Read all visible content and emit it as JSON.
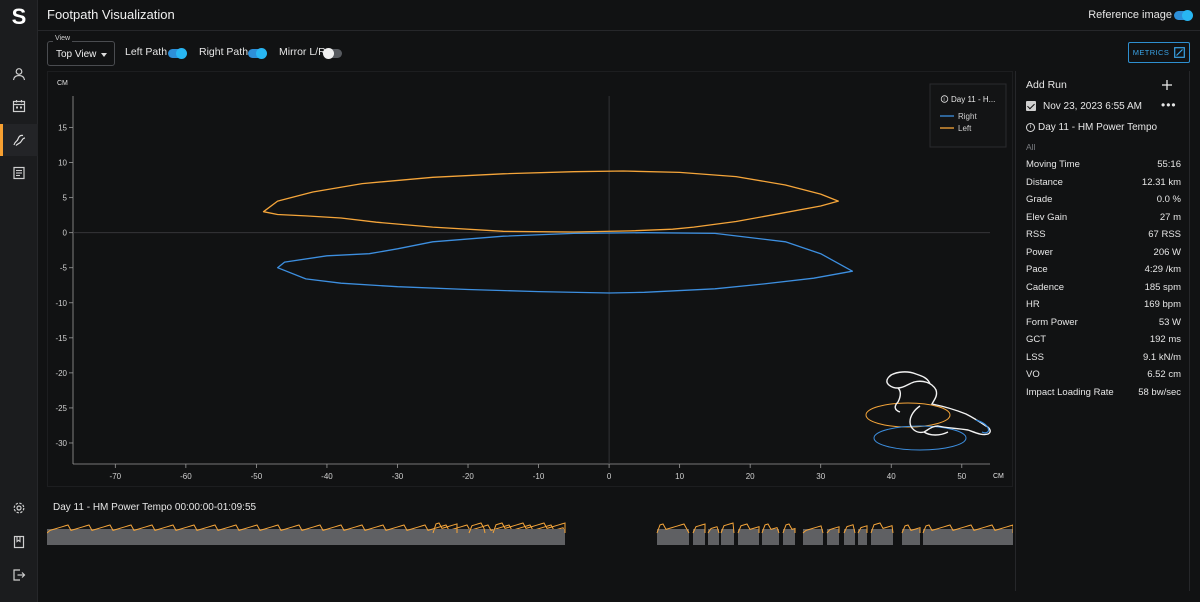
{
  "app": {
    "title": "Footpath Visualization",
    "logo": "S"
  },
  "header": {
    "reference_image_label": "Reference image",
    "reference_image_on": true
  },
  "sidebar": {
    "items": [
      {
        "icon": "user-icon"
      },
      {
        "icon": "calendar-icon"
      },
      {
        "icon": "footpath-icon",
        "active": true
      },
      {
        "icon": "report-icon"
      },
      {
        "icon": "gear-icon"
      },
      {
        "icon": "book-icon"
      },
      {
        "icon": "logout-icon"
      }
    ]
  },
  "controls": {
    "view_legend": "View",
    "view_value": "Top View",
    "left_path_label": "Left Path",
    "right_path_label": "Right Path",
    "mirror_label": "Mirror L/R",
    "left_path_on": true,
    "right_path_on": true,
    "mirror_on": false,
    "metrics_button": "METRICS"
  },
  "chart_data": {
    "type": "line",
    "xlabel": "CM",
    "ylabel": "CM",
    "xlim": [
      -76,
      54
    ],
    "ylim": [
      -33,
      19.5
    ],
    "x_ticks": [
      -70,
      -60,
      -50,
      -40,
      -30,
      -20,
      -10,
      0,
      10,
      20,
      30,
      40,
      50
    ],
    "y_ticks": [
      15,
      10,
      5,
      0,
      -5,
      -10,
      -15,
      -20,
      -25,
      -30
    ],
    "legend": {
      "title": "Day 11 - H...",
      "position": "top-right"
    },
    "series": [
      {
        "name": "Left",
        "color": "#f5a53a",
        "closed": true,
        "x": [
          -49,
          -47,
          -42,
          -35,
          -25,
          -15,
          -5,
          2,
          10,
          18,
          25,
          30,
          32.5,
          30,
          24,
          18,
          12,
          9,
          3,
          -5,
          -15,
          -25,
          -33,
          -38,
          -43,
          -47,
          -49
        ],
        "y": [
          3,
          4.5,
          5.8,
          7,
          7.9,
          8.4,
          8.7,
          8.8,
          8.6,
          8,
          6.8,
          5.5,
          4.5,
          3.8,
          2.7,
          1.6,
          0.8,
          0.5,
          0.25,
          0.1,
          0.2,
          0.8,
          1.5,
          2.1,
          2.4,
          2.6,
          3
        ]
      },
      {
        "name": "Right",
        "color": "#3d8fe0",
        "closed": true,
        "x": [
          -47,
          -46,
          -40,
          -34,
          -30,
          -25,
          -15,
          -5,
          5,
          15,
          25,
          30,
          34.5,
          29,
          22,
          15,
          5,
          0,
          -10,
          -20,
          -30,
          -38,
          -43,
          -47
        ],
        "y": [
          -5,
          -4.2,
          -3.3,
          -3,
          -2.3,
          -1.3,
          -0.5,
          -0.1,
          0,
          -0.1,
          -1.3,
          -3,
          -5.5,
          -6.5,
          -7.3,
          -8,
          -8.5,
          -8.6,
          -8.4,
          -8.1,
          -7.7,
          -7.2,
          -6.6,
          -5
        ]
      }
    ]
  },
  "run": {
    "add_run_label": "Add Run",
    "date": "Nov 23, 2023 6:55 AM",
    "name": "Day 11 - HM Power Tempo",
    "filter": "All",
    "metrics": [
      {
        "label": "Moving Time",
        "value": "55:16"
      },
      {
        "label": "Distance",
        "value": "12.31 km"
      },
      {
        "label": "Grade",
        "value": "0.0 %"
      },
      {
        "label": "Elev Gain",
        "value": "27 m"
      },
      {
        "label": "RSS",
        "value": "67 RSS"
      },
      {
        "label": "Power",
        "value": "206 W"
      },
      {
        "label": "Pace",
        "value": "4:29 /km"
      },
      {
        "label": "Cadence",
        "value": "185 spm"
      },
      {
        "label": "HR",
        "value": "169 bpm"
      },
      {
        "label": "Form Power",
        "value": "53 W"
      },
      {
        "label": "GCT",
        "value": "192 ms"
      },
      {
        "label": "LSS",
        "value": "9.1 kN/m"
      },
      {
        "label": "VO",
        "value": "6.52 cm"
      },
      {
        "label": "Impact Loading Rate",
        "value": "58 bw/sec"
      }
    ]
  },
  "timeline": {
    "label": "Day 11 - HM Power Tempo  00:00:00-01:09:55",
    "color": "#f5a53a"
  }
}
